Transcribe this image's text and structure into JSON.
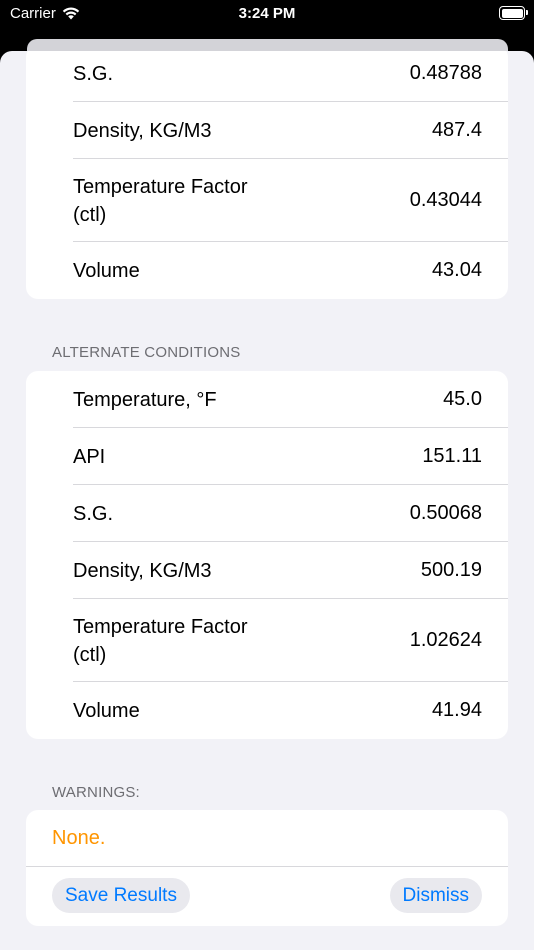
{
  "status": {
    "carrier": "Carrier",
    "time": "3:24 PM"
  },
  "top_group": [
    {
      "label": "S.G.",
      "value": "0.48788"
    },
    {
      "label": "Density, KG/M3",
      "value": "487.4"
    },
    {
      "label": "Temperature Factor (ctl)",
      "value": "0.43044"
    },
    {
      "label": "Volume",
      "value": "43.04"
    }
  ],
  "alternate": {
    "header": "ALTERNATE CONDITIONS",
    "rows": [
      {
        "label": "Temperature, °F",
        "value": "45.0"
      },
      {
        "label": "API",
        "value": "151.11"
      },
      {
        "label": "S.G.",
        "value": "0.50068"
      },
      {
        "label": "Density, KG/M3",
        "value": "500.19"
      },
      {
        "label": "Temperature Factor (ctl)",
        "value": "1.02624"
      },
      {
        "label": "Volume",
        "value": "41.94"
      }
    ]
  },
  "warnings": {
    "header": "WARNINGS:",
    "text": "None.",
    "save_label": "Save Results",
    "dismiss_label": "Dismiss"
  },
  "colors": {
    "accent": "#007aff",
    "warning": "#ff9500",
    "background": "#f2f2f7"
  }
}
